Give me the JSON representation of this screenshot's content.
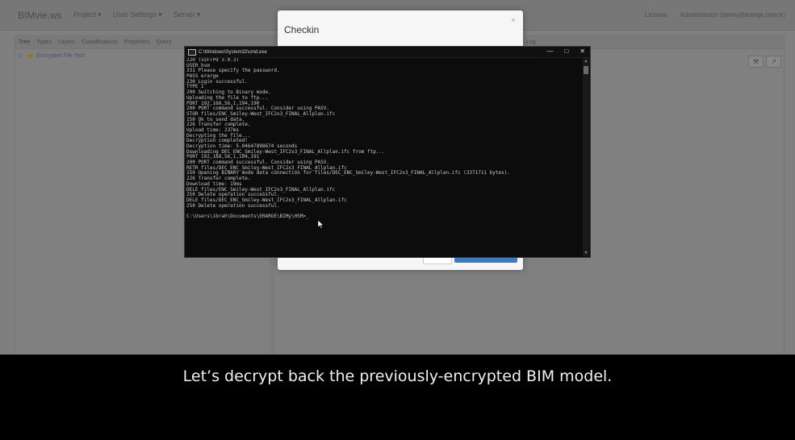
{
  "navbar": {
    "brand": "BIMvie.ws",
    "menu": [
      "Project ▾",
      "User Settings ▾",
      "Server ▾"
    ],
    "right": [
      "License",
      "Administrator (demo@erarge.com.tr)"
    ]
  },
  "left_panel": {
    "tabs": [
      "Tree",
      "Types",
      "Layers",
      "Classifications",
      "Properties",
      "Query"
    ],
    "tree_item": "Encrypted File Test"
  },
  "right_panel": {
    "log_label": "Log"
  },
  "modal": {
    "title": "Checkin",
    "close_symbol": "×",
    "close_label": "Close",
    "checkin_label": "Checkin new revision"
  },
  "cmd": {
    "title": "C:\\Windows\\System32\\cmd.exe",
    "controls": [
      "—",
      "□",
      "✕"
    ],
    "lines": [
      "220 (vsFTPd 3.0.3)",
      "USER hsm",
      "331 Please specify the password.",
      "PASS erarge",
      "230 Login successful.",
      "TYPE I",
      "200 Switching to Binary mode.",
      "Uploading the file to ftp...",
      "PORT 192,168,56,1,194,190",
      "200 PORT command successful. Consider using PASV.",
      "STOR files/ENC_Smiley-West_IFC2x3_FINAL_Allplan.ifc",
      "150 Ok to send data.",
      "226 Transfer complete.",
      "Upload time: 237ms",
      "Decrypting the file...",
      "Decryption completed!",
      "Decryption time: 5.04647898674 seconds",
      "Downloading DEC_ENC_Smiley-West_IFC2x3_FINAL_Allplan.ifc from ftp...",
      "PORT 192,168,56,1,194,191",
      "200 PORT command successful. Consider using PASV.",
      "RETR files/DEC_ENC_Smiley-West_IFC2x3_FINAL_Allplan.ifc",
      "150 Opening BINARY mode data connection for files/DEC_ENC_Smiley-West_IFC2x3_FINAL_Allplan.ifc (3371711 bytes).",
      "226 Transfer complete.",
      "Download time: 19ms",
      "DELE files/ENC_Smiley-West_IFC2x3_FINAL_Allplan.ifc",
      "250 Delete operation successful.",
      "DELE files/DEC_ENC_Smiley-West_IFC2x3_FINAL_Allplan.ifc",
      "250 Delete operation successful.",
      "",
      "C:\\Users\\ibrah\\Documents\\ERARGE\\BIMy\\HSM>_"
    ]
  },
  "caption": "Let’s decrypt back the previously-encrypted BIM model."
}
